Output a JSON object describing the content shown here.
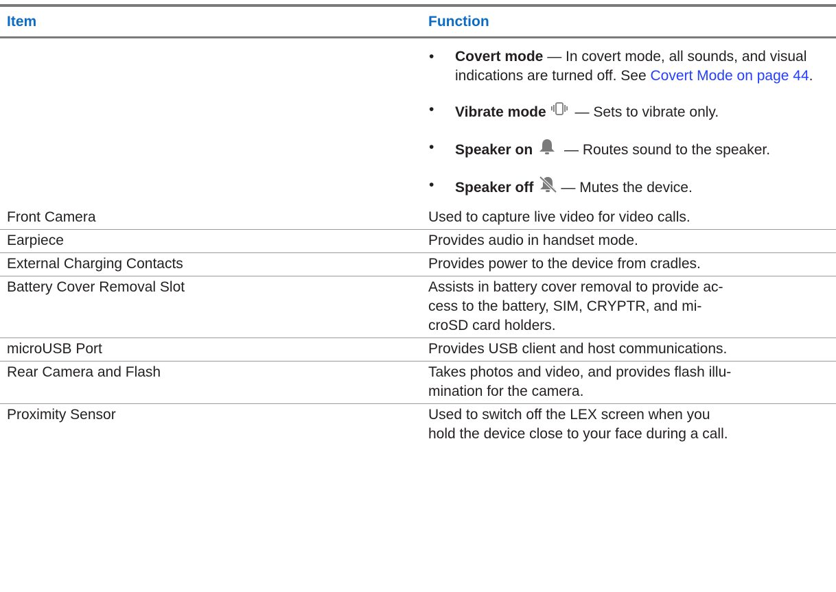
{
  "table": {
    "headers": {
      "item": "Item",
      "function": "Function"
    },
    "modes": [
      {
        "term": "Covert mode",
        "icon": "",
        "text": " — In covert mode, all sounds, and visual indications are turned off. See ",
        "link": "Covert Mode on page 44",
        "suffix": "."
      },
      {
        "term": "Vibrate mode",
        "icon": "vibrate-icon",
        "text": " — Sets to vibrate only."
      },
      {
        "term": "Speaker on",
        "icon": "bell-icon",
        "text": " — Routes sound to the speaker."
      },
      {
        "term": "Speaker off",
        "icon": "bell-off-icon",
        "text": "— Mutes the device."
      }
    ],
    "bullet": "•",
    "rows": [
      {
        "item": "Front Camera",
        "function": "Used to capture live video for video calls."
      },
      {
        "item": "Earpiece",
        "function": "Provides audio in handset mode."
      },
      {
        "item": "External Charging Contacts",
        "function": "Provides power to the device from cradles."
      },
      {
        "item": "Battery Cover Removal Slot",
        "function": "Assists in battery cover removal to provide ac-\ncess to the battery, SIM, CRYPTR, and mi-\ncroSD card holders."
      },
      {
        "item": "microUSB Port",
        "function": "Provides USB client and host communications."
      },
      {
        "item": "Rear Camera and Flash",
        "function": "Takes photos and video, and provides flash illu-\nmination for the camera."
      },
      {
        "item": "Proximity Sensor",
        "function": "Used to switch off the LEX screen when you\nhold the device close to your face during a call."
      }
    ]
  },
  "colors": {
    "header_text": "#0c6bc4",
    "link": "#2440ff",
    "body_text": "#231f20",
    "rule": "#7a7a7a"
  }
}
